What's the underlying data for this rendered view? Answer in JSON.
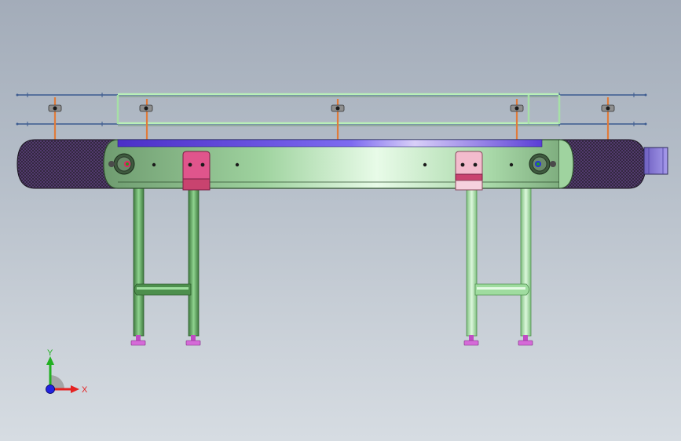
{
  "triad": {
    "x_label": "X",
    "y_label": "Y"
  },
  "colors": {
    "background_top": "#a3acb9",
    "background_bottom": "#d6dce2",
    "frame": "#a6e0a6",
    "belt_top": "#6a4ee0",
    "belt_mesh": "#2a2030",
    "motor": "#8e7ed8",
    "guide_rail": "#a6e0a6",
    "bracket": "#e0558c",
    "bracket_light": "#f1b8cc",
    "leg": "#79c879",
    "leg_light": "#b9efb9",
    "foot": "#d56ad8",
    "axis_x": "#e52222",
    "axis_y": "#22b022",
    "axis_z": "#2222e0"
  },
  "icons": {
    "triad": "coordinate-triad-icon"
  }
}
